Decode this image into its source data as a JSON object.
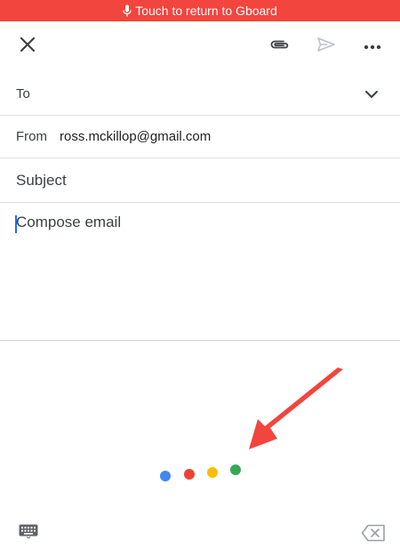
{
  "banner": {
    "text": "Touch to return to Gboard",
    "icon": "microphone-icon"
  },
  "toolbar": {
    "close_icon": "close-icon",
    "attach_icon": "paperclip-icon",
    "send_icon": "send-icon",
    "more_icon": "more-horizontal-icon"
  },
  "fields": {
    "to_label": "To",
    "from_label": "From",
    "from_value": "ross.mckillop@gmail.com",
    "subject_placeholder": "Subject",
    "compose_placeholder": "Compose email"
  },
  "voice": {
    "dot_colors": [
      "#4285f4",
      "#ea4335",
      "#fbbc05",
      "#34a853"
    ],
    "arrow_color": "#f2453d"
  },
  "keyboard_bar": {
    "keyboard_icon": "keyboard-icon",
    "backspace_icon": "backspace-icon"
  },
  "colors": {
    "banner": "#f2453d",
    "accent": "#1a73e8"
  }
}
